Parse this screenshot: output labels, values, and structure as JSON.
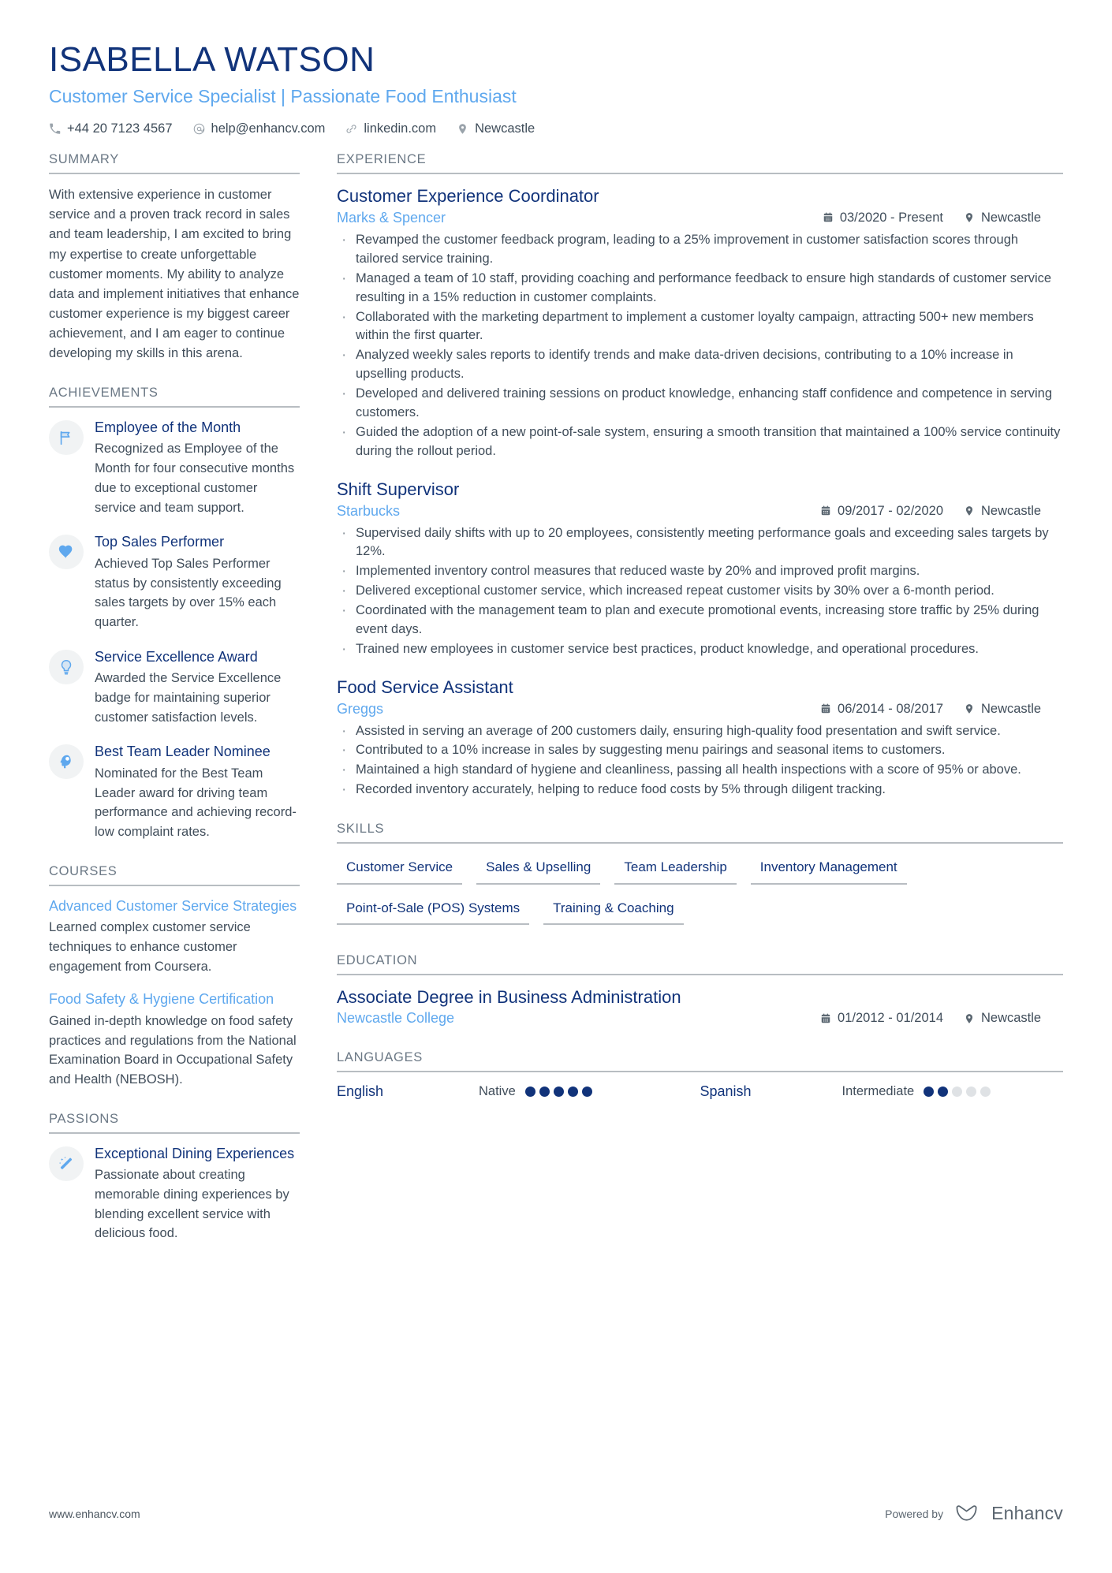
{
  "header": {
    "name": "ISABELLA WATSON",
    "role": "Customer Service Specialist | Passionate Food Enthusiast",
    "contacts": [
      {
        "icon": "phone-icon",
        "text": "+44 20 7123 4567"
      },
      {
        "icon": "email-icon",
        "text": "help@enhancv.com"
      },
      {
        "icon": "link-icon",
        "text": "linkedin.com"
      },
      {
        "icon": "location-pin-icon",
        "text": "Newcastle"
      }
    ]
  },
  "colors": {
    "name_navy": "#11337a",
    "accent_blue": "#5fa8ee",
    "body_text": "#404d5a",
    "rule_gray": "#b8bdc2",
    "badge_bg": "#f1f3f4",
    "dot_off": "#dfe2e5"
  },
  "left": {
    "summary": {
      "title": "SUMMARY",
      "text": "With extensive experience in customer service and a proven track record in sales and team leadership, I am excited to bring my expertise to create unforgettable customer moments. My ability to analyze data and implement initiatives that enhance customer experience is my biggest career achievement, and I am eager to continue developing my skills in this arena."
    },
    "achievements": {
      "title": "ACHIEVEMENTS",
      "items": [
        {
          "icon": "flag-icon",
          "title": "Employee of the Month",
          "desc": "Recognized as Employee of the Month for four consecutive months due to exceptional customer service and team support."
        },
        {
          "icon": "heart-icon",
          "title": "Top Sales Performer",
          "desc": "Achieved Top Sales Performer status by consistently exceeding sales targets by over 15% each quarter."
        },
        {
          "icon": "lightbulb-icon",
          "title": "Service Excellence Award",
          "desc": "Awarded the Service Excellence badge for maintaining superior customer satisfaction levels."
        },
        {
          "icon": "head-brain-icon",
          "title": "Best Team Leader Nominee",
          "desc": "Nominated for the Best Team Leader award for driving team performance and achieving record-low complaint rates."
        }
      ]
    },
    "courses": {
      "title": "COURSES",
      "items": [
        {
          "title": "Advanced Customer Service Strategies",
          "desc": "Learned complex customer service techniques to enhance customer engagement from Coursera."
        },
        {
          "title": "Food Safety & Hygiene Certification",
          "desc": "Gained in-depth knowledge on food safety practices and regulations from the National Examination Board in Occupational Safety and Health (NEBOSH)."
        }
      ]
    },
    "passions": {
      "title": "PASSIONS",
      "items": [
        {
          "icon": "magic-wand-icon",
          "title": "Exceptional Dining Experiences",
          "desc": "Passionate about creating memorable dining experiences by blending excellent service with delicious food."
        }
      ]
    }
  },
  "right": {
    "experience": {
      "title": "EXPERIENCE",
      "jobs": [
        {
          "role": "Customer Experience Coordinator",
          "company": "Marks & Spencer",
          "dates": "03/2020 - Present",
          "location": "Newcastle",
          "bullets": [
            "Revamped the customer feedback program, leading to a 25% improvement in customer satisfaction scores through tailored service training.",
            "Managed a team of 10 staff, providing coaching and performance feedback to ensure high standards of customer service resulting in a 15% reduction in customer complaints.",
            "Collaborated with the marketing department to implement a customer loyalty campaign, attracting 500+ new members within the first quarter.",
            "Analyzed weekly sales reports to identify trends and make data-driven decisions, contributing to a 10% increase in upselling products.",
            "Developed and delivered training sessions on product knowledge, enhancing staff confidence and competence in serving customers.",
            "Guided the adoption of a new point-of-sale system, ensuring a smooth transition that maintained a 100% service continuity during the rollout period."
          ]
        },
        {
          "role": "Shift Supervisor",
          "company": "Starbucks",
          "dates": "09/2017 - 02/2020",
          "location": "Newcastle",
          "bullets": [
            "Supervised daily shifts with up to 20 employees, consistently meeting performance goals and exceeding sales targets by 12%.",
            "Implemented inventory control measures that reduced waste by 20% and improved profit margins.",
            "Delivered exceptional customer service, which increased repeat customer visits by 30% over a 6-month period.",
            "Coordinated with the management team to plan and execute promotional events, increasing store traffic by 25% during event days.",
            "Trained new employees in customer service best practices, product knowledge, and operational procedures."
          ]
        },
        {
          "role": "Food Service Assistant",
          "company": "Greggs",
          "dates": "06/2014 - 08/2017",
          "location": "Newcastle",
          "bullets": [
            "Assisted in serving an average of 200 customers daily, ensuring high-quality food presentation and swift service.",
            "Contributed to a 10% increase in sales by suggesting menu pairings and seasonal items to customers.",
            "Maintained a high standard of hygiene and cleanliness, passing all health inspections with a score of 95% or above.",
            "Recorded inventory accurately, helping to reduce food costs by 5% through diligent tracking."
          ]
        }
      ]
    },
    "skills": {
      "title": "SKILLS",
      "items": [
        "Customer Service",
        "Sales & Upselling",
        "Team Leadership",
        "Inventory Management",
        "Point-of-Sale (POS) Systems",
        "Training & Coaching"
      ]
    },
    "education": {
      "title": "EDUCATION",
      "items": [
        {
          "degree": "Associate Degree in Business Administration",
          "school": "Newcastle College",
          "dates": "01/2012 - 01/2014",
          "location": "Newcastle"
        }
      ]
    },
    "languages": {
      "title": "LANGUAGES",
      "items": [
        {
          "name": "English",
          "level": "Native",
          "filled": 5,
          "total": 5
        },
        {
          "name": "Spanish",
          "level": "Intermediate",
          "filled": 2,
          "total": 5
        }
      ]
    }
  },
  "footer": {
    "url": "www.enhancv.com",
    "powered_by": "Powered by",
    "brand": "Enhancv"
  }
}
